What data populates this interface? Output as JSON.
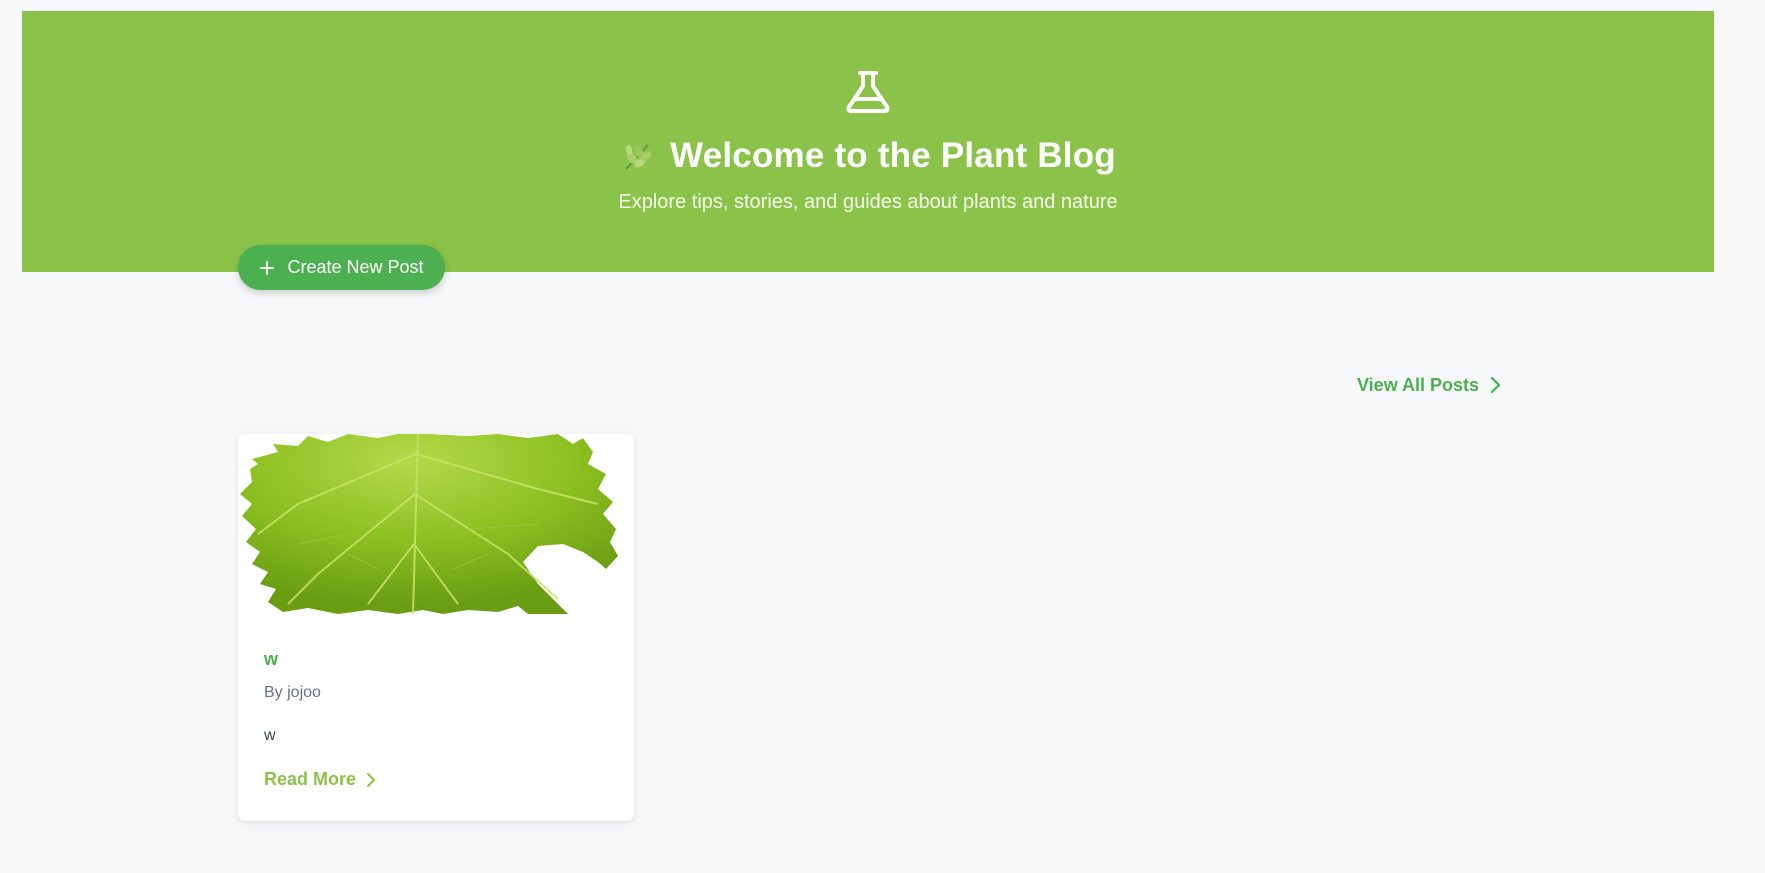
{
  "hero": {
    "icon": "flask-icon",
    "title_emoji": "herb-leaf-icon",
    "title": "Welcome to the Plant Blog",
    "subtitle": "Explore tips, stories, and guides about plants and nature",
    "background_color": "#8bc34a"
  },
  "actions": {
    "create_label": "Create New Post",
    "create_icon": "plus-icon",
    "create_color": "#4caf50",
    "view_all_label": "View All Posts",
    "view_all_icon": "chevron-right-icon"
  },
  "posts": [
    {
      "image": "green-leaf-image",
      "title": "w",
      "author": "By jojoo",
      "excerpt": "w",
      "read_more_label": "Read More",
      "read_more_icon": "chevron-right-icon"
    }
  ],
  "colors": {
    "accent_green": "#4caf50",
    "light_green": "#8bc34a",
    "page_background": "#f7f8fa"
  }
}
